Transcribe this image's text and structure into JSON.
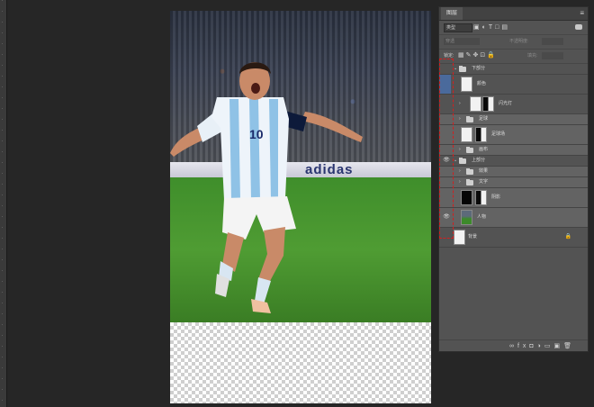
{
  "board_text": "adidas",
  "jersey_number": "10",
  "panel": {
    "tab": "图层",
    "filter": "类型",
    "blend_mode": "穿透",
    "opacity_label": "不透明度:",
    "lock_label": "锁定:",
    "fill_label": "填充:",
    "filter_icons": "▣◐T□▤",
    "lock_icons": "▦✎✥⊡🔒",
    "footer_icons": "∞fx◘◑▭▣🗑"
  },
  "layers": [
    {
      "name": "下部分",
      "type": "group-open",
      "visible": false
    },
    {
      "name": "颜色",
      "type": "layer",
      "selected": true
    },
    {
      "name": "闪光灯",
      "type": "group"
    },
    {
      "name": "足球",
      "type": "group"
    },
    {
      "name": "足球场",
      "type": "layer"
    },
    {
      "name": "画布",
      "type": "group"
    },
    {
      "name": "上部分",
      "type": "group-open",
      "visible": true
    },
    {
      "name": "效果",
      "type": "group"
    },
    {
      "name": "文字",
      "type": "group"
    },
    {
      "name": "阴影",
      "type": "layer"
    },
    {
      "name": "人物",
      "type": "layer",
      "visible": true
    },
    {
      "name": "背景",
      "type": "background"
    }
  ]
}
